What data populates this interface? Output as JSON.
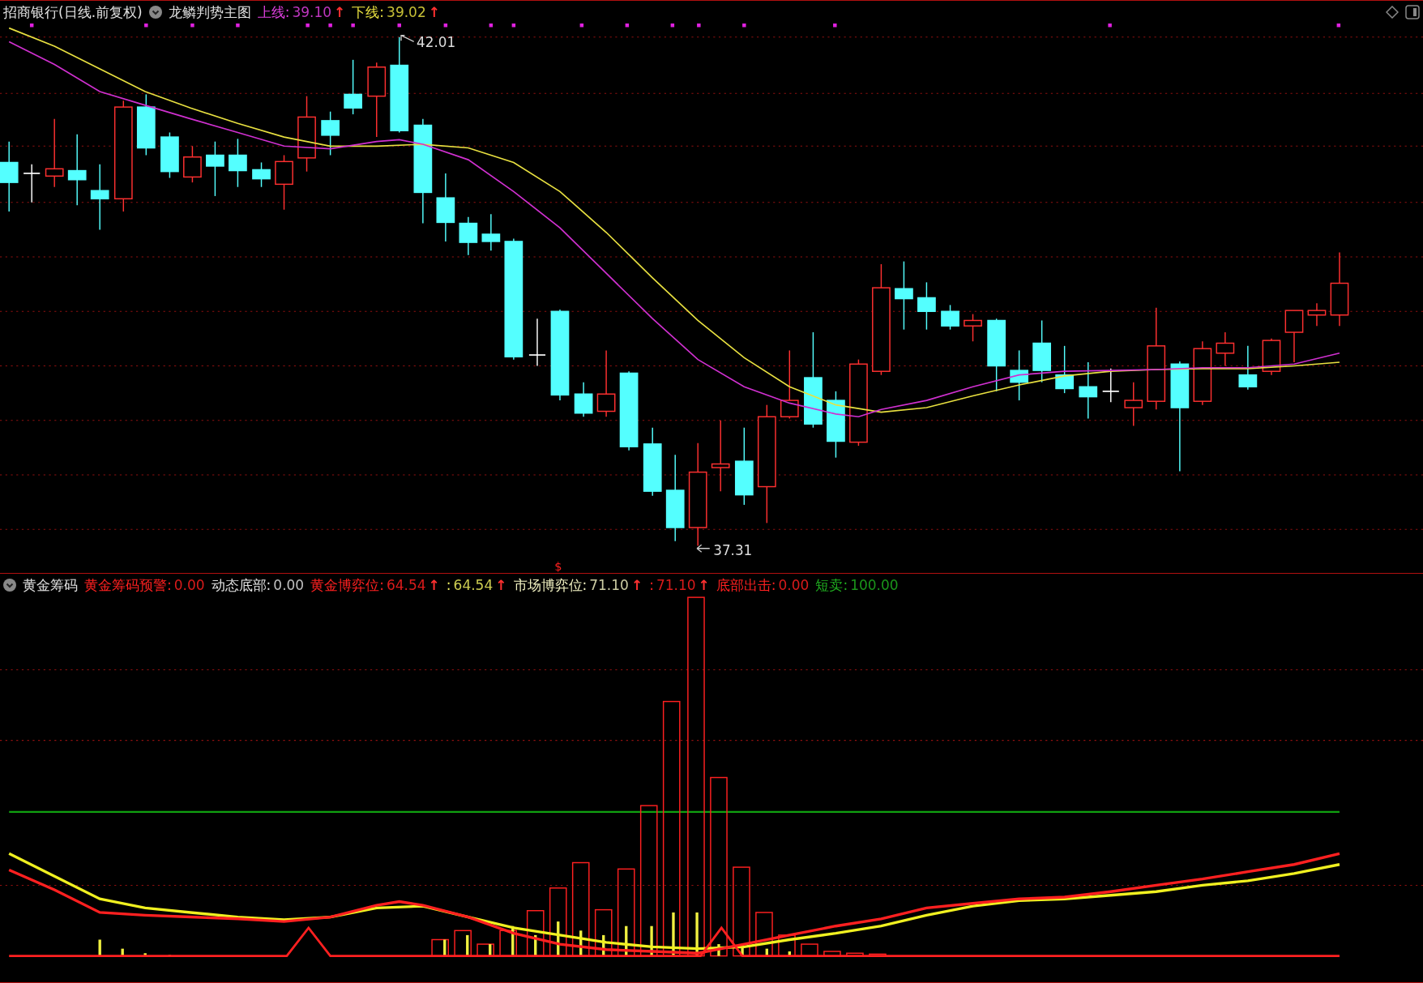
{
  "main_chart": {
    "title": "招商银行(日线.前复权)",
    "indicator": "龙鳞判势主图",
    "legend": [
      {
        "label": "上线:",
        "value": "39.10",
        "arrow": "↑",
        "color": "#e040e0"
      },
      {
        "label": "下线:",
        "value": "39.02",
        "arrow": "↑",
        "color": "#e8e040"
      }
    ],
    "annotations": [
      {
        "kind": "high",
        "text": "42.01"
      },
      {
        "kind": "low",
        "text": "37.31"
      },
      {
        "kind": "signal",
        "text": "$"
      }
    ]
  },
  "sub_chart": {
    "title": "黄金筹码",
    "legend": [
      {
        "label": "黄金筹码预警:",
        "value": "0.00",
        "color": "#ff2020"
      },
      {
        "label": "动态底部:",
        "value": "0.00",
        "color": "#e0e0e0"
      },
      {
        "label": "黄金博弈位:",
        "value": "64.54",
        "arrow": "↑",
        "color": "#ff2020"
      },
      {
        "label": ":",
        "value": "64.54",
        "arrow": "↑",
        "color": "#f0f060"
      },
      {
        "label": "市场博弈位:",
        "value": "71.10",
        "arrow": "↑",
        "color": "#f0f0c0"
      },
      {
        "label": ":",
        "value": "71.10",
        "arrow": "↑",
        "color": "#ff2020"
      },
      {
        "label": "底部出击:",
        "value": "0.00",
        "color": "#ff2020"
      },
      {
        "label": "短卖:",
        "value": "100.00",
        "color": "#20b020"
      }
    ]
  }
}
